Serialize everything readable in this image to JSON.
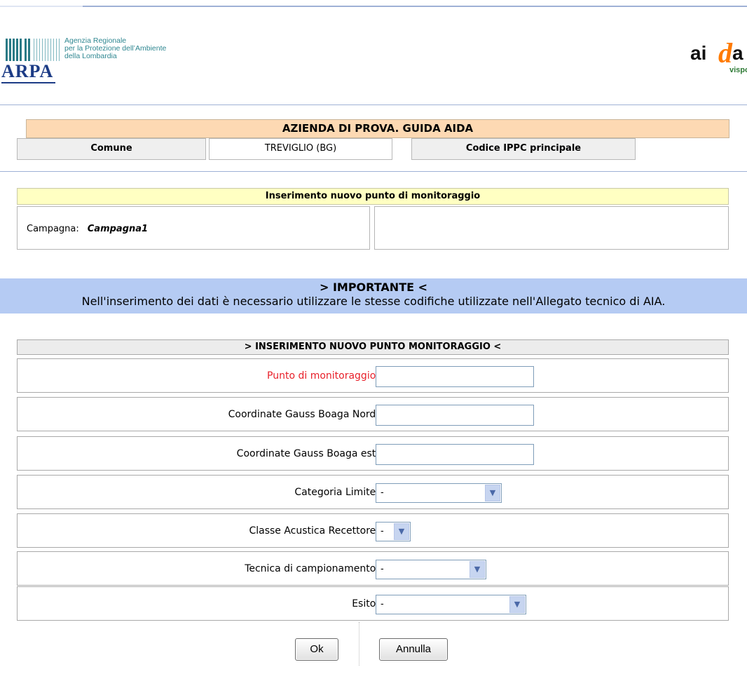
{
  "header": {
    "arpa_org_lines": [
      "Agenzia Regionale",
      "per la Protezione dell’Ambiente",
      "della Lombardia"
    ],
    "arpa_logo_word": "ARPA",
    "aida_logo": {
      "part1": "ai",
      "letter": "d",
      "part2": "a",
      "sub": "vispo"
    }
  },
  "company": {
    "name": "AZIENDA DI PROVA. GUIDA AIDA",
    "comune_label": "Comune",
    "comune_value": "TREVIGLIO (BG)",
    "ippc_label": "Codice IPPC principale"
  },
  "insert_section": {
    "title": "Inserimento nuovo punto di monitoraggio",
    "campagna_label": "Campagna:",
    "campagna_value": "Campagna1"
  },
  "important": {
    "title": "> IMPORTANTE <",
    "message": "Nell'inserimento dei dati è necessario utilizzare le stesse codifiche utilizzate nell'Allegato tecnico di AIA."
  },
  "form": {
    "title": "> INSERIMENTO NUOVO PUNTO MONITORAGGIO <",
    "fields": {
      "punto": {
        "label": "Punto di monitoraggio:",
        "value": ""
      },
      "gb_nord": {
        "label": "Coordinate Gauss Boaga Nord:",
        "value": ""
      },
      "gb_est": {
        "label": "Coordinate Gauss Boaga est:",
        "value": ""
      },
      "categoria": {
        "label": "Categoria Limite:",
        "selected": "-"
      },
      "classe": {
        "label": "Classe Acustica Recettore:",
        "selected": "-"
      },
      "tecnica": {
        "label": "Tecnica di campionamento:",
        "selected": "-"
      },
      "esito": {
        "label": "Esito:",
        "selected": "-"
      }
    },
    "ok_label": "Ok",
    "cancel_label": "Annulla"
  },
  "colors": {
    "company_bg": "#fdd9b3",
    "section_bg": "#ffffc2",
    "important_bg": "#b5cbf3",
    "required_label": "#e8202a"
  }
}
